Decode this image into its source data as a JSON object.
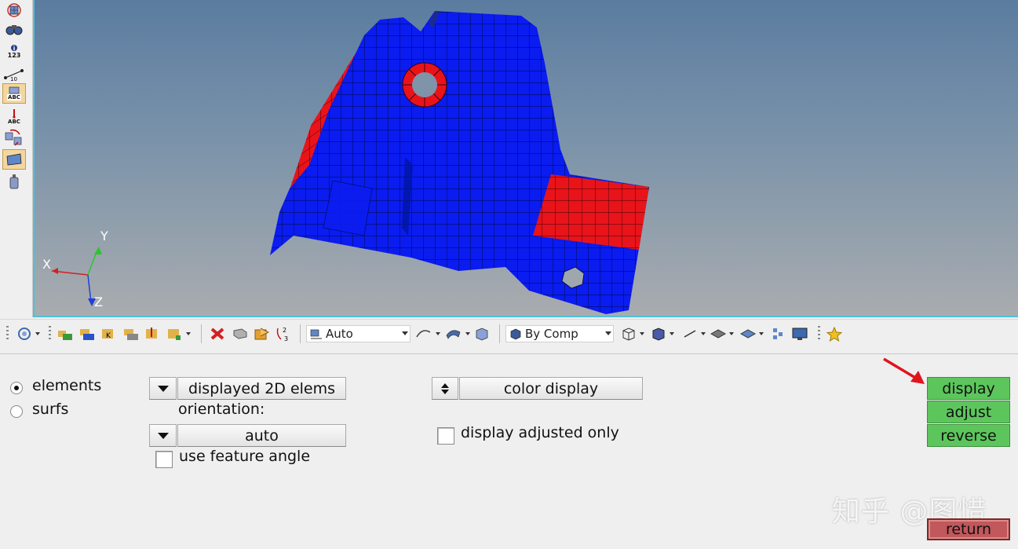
{
  "left_toolbar": {
    "tools": [
      {
        "name": "mesh-view-icon",
        "text": ""
      },
      {
        "name": "find-binoculars-icon",
        "text": ""
      },
      {
        "name": "numbers-icon",
        "text": "123"
      },
      {
        "name": "measure-icon",
        "text": "10"
      },
      {
        "name": "label-abc-icon",
        "text": "ABC"
      },
      {
        "name": "element-normal-abc-icon",
        "text": "ABC"
      },
      {
        "name": "reorient-icon",
        "text": ""
      },
      {
        "name": "surface-display-icon",
        "text": ""
      },
      {
        "name": "mass-weight-icon",
        "text": ""
      }
    ]
  },
  "viewport": {
    "triad": {
      "x_label": "X",
      "y_label": "Y",
      "z_label": "Z"
    },
    "colors": {
      "mesh_blue": "#0a1cf0",
      "mesh_red": "#e8141a",
      "triad_x": "#d42020",
      "triad_y": "#2ec42e",
      "triad_z": "#2040d8"
    }
  },
  "toolbar": {
    "auto_combo": "Auto",
    "by_comp_combo": "By Comp"
  },
  "panel": {
    "radio_elements": "elements",
    "radio_surfs": "surfs",
    "selector_value": "displayed 2D elems",
    "orientation_label": "orientation:",
    "orientation_value": "auto",
    "use_feature_angle": "use feature angle",
    "color_display": "color display",
    "display_adjusted_only": "display adjusted only"
  },
  "actions": {
    "display": "display",
    "adjust": "adjust",
    "reverse": "reverse",
    "return": "return"
  },
  "watermark": "知乎 @图惜",
  "colors": {
    "accent_green": "#5cc65c",
    "return_red": "#c1585c",
    "annotation_arrow": "#e0141e"
  }
}
